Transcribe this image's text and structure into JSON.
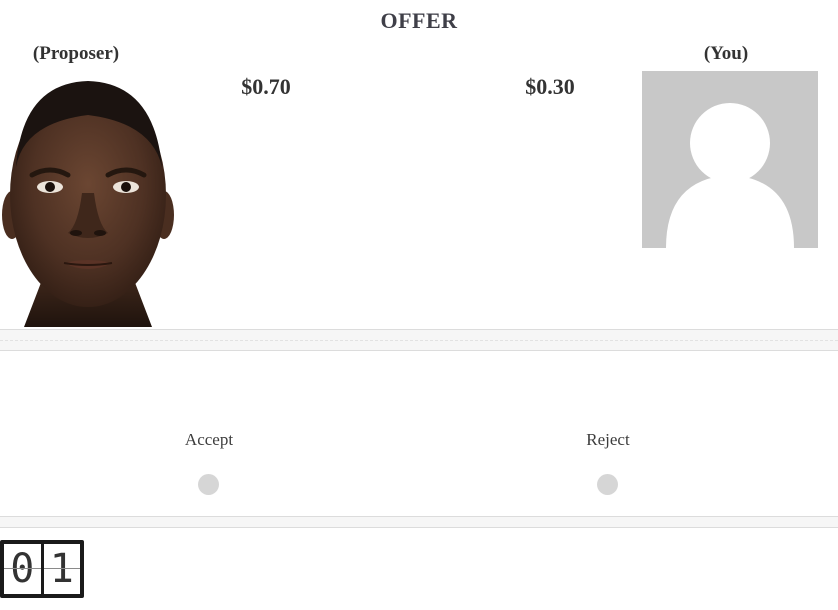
{
  "offer": {
    "title": "OFFER",
    "proposer_label": "(Proposer)",
    "you_label": "(You)",
    "proposer_amount": "$0.70",
    "you_amount": "$0.30"
  },
  "icons": {
    "proposer_photo": "face-photo",
    "you_photo": "person-silhouette-icon"
  },
  "choices": {
    "accept_label": "Accept",
    "reject_label": "Reject"
  },
  "timer": {
    "digit_1": "0",
    "digit_2": "1"
  },
  "colors": {
    "placeholder_bg": "#c8c8c8",
    "radio": "#d6d6d6",
    "timer_bg": "#1a1a1a"
  }
}
